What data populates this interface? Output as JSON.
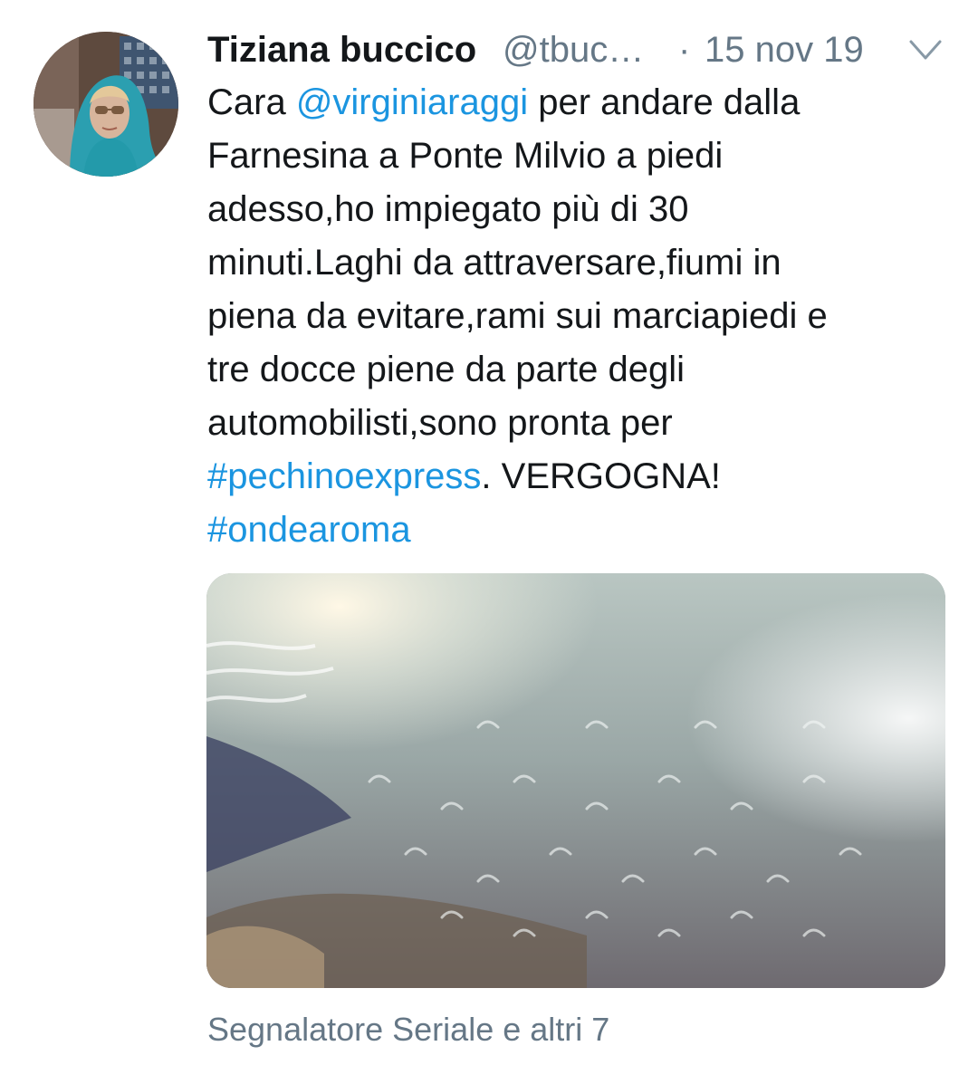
{
  "tweet": {
    "display_name": "Tiziana buccico",
    "handle": "@tbuc…",
    "separator": "·",
    "date": "15 nov 19",
    "menu_icon": "chevron-down-icon",
    "text": {
      "line1_pre": "Cara ",
      "line1_mention": "@virginiaraggi",
      "line1_post": " per andare dalla",
      "line2": "Farnesina a Ponte Milvio a piedi",
      "line3": "adesso,ho impiegato più di 30",
      "line4": "minuti.Laghi da attraversare,fiumi in",
      "line5": "piena da evitare,rami sui marciapiedi e",
      "line6": "tre docce piene da parte degli",
      "line7": "automobilisti,sono pronta per",
      "line8_hashtag": "#pechinoexpress",
      "line8_post": ". VERGOGNA!",
      "line9_hashtag": "#ondearoma"
    },
    "social_context": "Segnalatore Seriale e altri 7",
    "colors": {
      "link": "#1b95e0",
      "secondary_text": "#657786",
      "primary_text": "#14171a"
    }
  }
}
